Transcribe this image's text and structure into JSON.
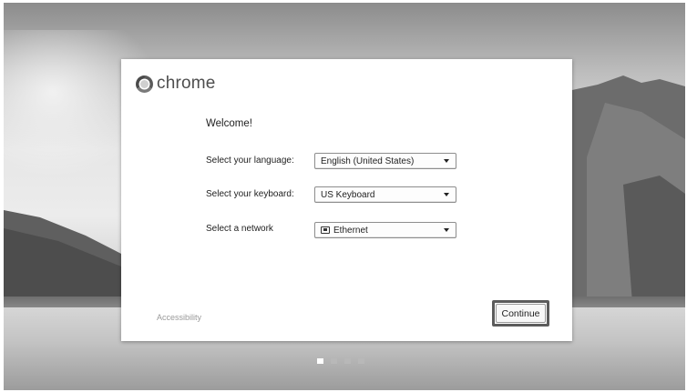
{
  "logo": {
    "text": "chrome",
    "icon": "chrome-logo-icon"
  },
  "welcome": "Welcome!",
  "fields": {
    "language": {
      "label": "Select your language:",
      "value": "English (United States)"
    },
    "keyboard": {
      "label": "Select your keyboard:",
      "value": "US Keyboard"
    },
    "network": {
      "label": "Select a network",
      "value": "Ethernet",
      "icon": "ethernet-icon"
    }
  },
  "accessibility": "Accessibility",
  "continue_label": "Continue",
  "pager": {
    "total": 4,
    "active_index": 0
  }
}
